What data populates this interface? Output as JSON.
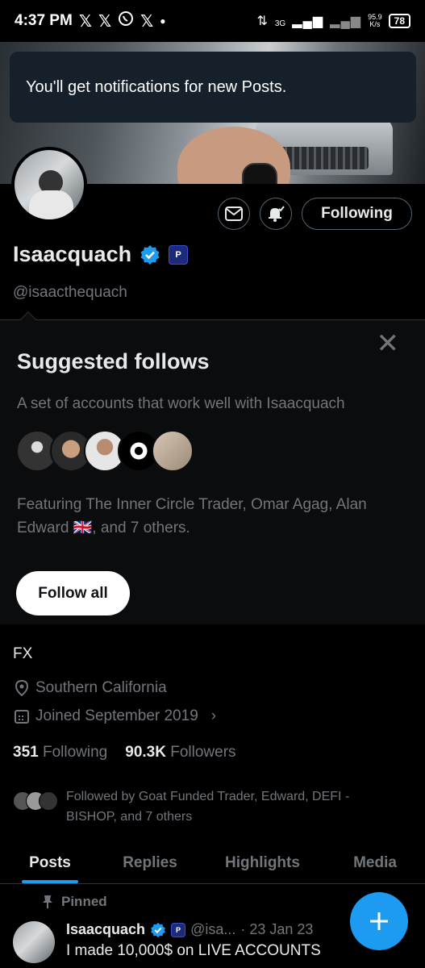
{
  "status_bar": {
    "time": "4:37 PM",
    "notif_icons": [
      "X",
      "X",
      "whatsapp",
      "X"
    ],
    "network": "3G",
    "speed_value": "95.9",
    "speed_unit": "K/s",
    "battery": "78"
  },
  "toast": {
    "message": "You'll get notifications for new Posts."
  },
  "profile": {
    "name": "Isaacquach",
    "handle": "@isaacthequach",
    "affiliate_badge": "P",
    "bio": "FX",
    "location": "Southern California",
    "joined": "Joined September 2019",
    "following_count": "351",
    "following_label": "Following",
    "followers_count": "90.3K",
    "followers_label": "Followers",
    "followed_by": "Followed by Goat Funded Trader, Edward, DEFI - BISHOP, and 7 others"
  },
  "actions": {
    "following_button": "Following"
  },
  "suggested": {
    "title": "Suggested follows",
    "description": "A set of accounts that work well with Isaacquach",
    "featuring": "Featuring The Inner Circle Trader, Omar Agag, Alan Edward 🇬🇧, and 7 others.",
    "follow_all_label": "Follow all",
    "close_glyph": "✕"
  },
  "tabs": [
    "Posts",
    "Replies",
    "Highlights",
    "Media"
  ],
  "pinned_post": {
    "pinned_label": "Pinned",
    "author": "Isaacquach",
    "handle_short": "@isa...",
    "date": "· 23 Jan 23",
    "text": "I made 10,000$ on LIVE ACCOUNTS"
  },
  "colors": {
    "accent": "#1d9bf0",
    "background": "#000000",
    "muted": "#71767b",
    "toast_bg": "#15202b"
  }
}
